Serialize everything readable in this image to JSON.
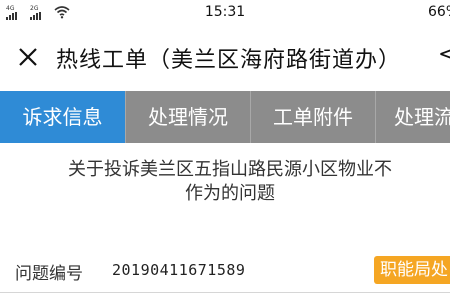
{
  "status_bar": {
    "sim1_label": "4G",
    "sim2_label": "2G",
    "time": "15:31",
    "battery": "66%",
    "icons": [
      "signal-icon",
      "signal-icon",
      "wifi-icon"
    ]
  },
  "nav": {
    "title": "热线工单（美兰区海府路街道办）",
    "more": "<",
    "icons": [
      "close-icon"
    ]
  },
  "tabs": [
    {
      "label": "诉求信息",
      "active": true
    },
    {
      "label": "处理情况",
      "active": false
    },
    {
      "label": "工单附件",
      "active": false
    },
    {
      "label": "处理流",
      "active": false
    }
  ],
  "detail": {
    "subject_line1": "关于投诉美兰区五指山路民源小区物业不",
    "subject_line2": "作为的问题",
    "issue_no_label": "问题编号",
    "issue_no_value": "20190411671589",
    "dept_badge": "职能局处"
  },
  "colors": {
    "tab_active": "#2f8bd6",
    "tab_bg": "#8c8c8c",
    "badge": "#f5a623"
  }
}
